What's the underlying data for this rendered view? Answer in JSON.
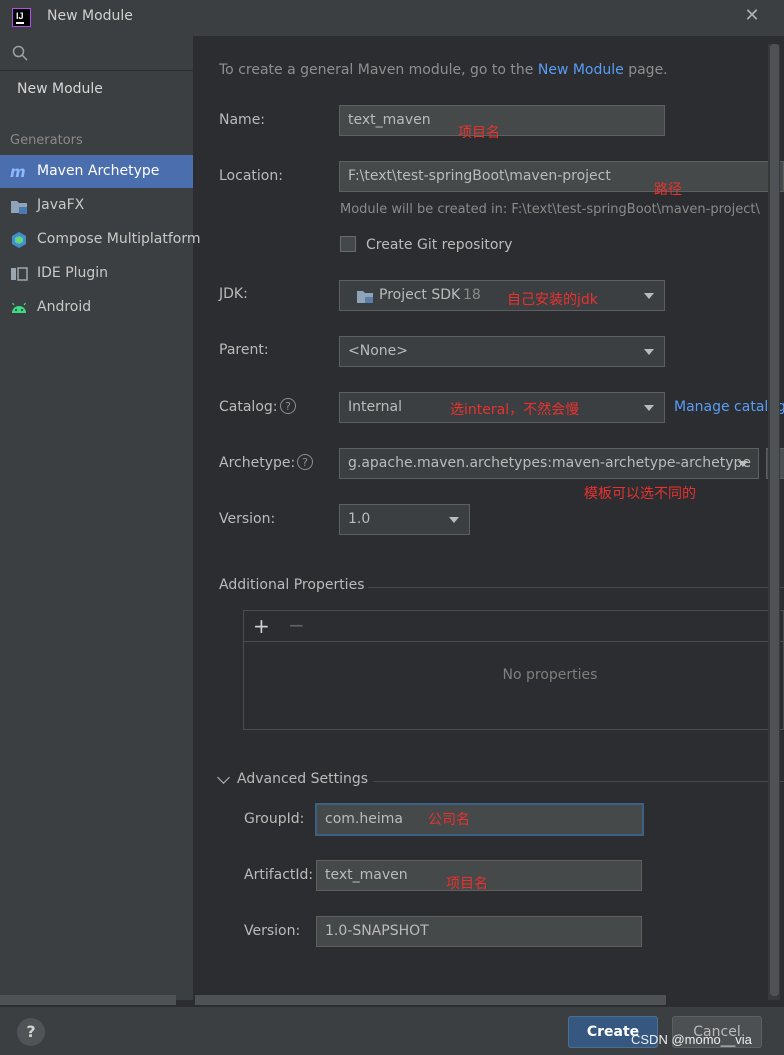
{
  "window": {
    "title": "New Module"
  },
  "sidebar": {
    "new_module": "New Module",
    "generators_label": "Generators",
    "items": [
      {
        "label": "Maven Archetype",
        "icon": "maven-icon",
        "selected": true
      },
      {
        "label": "JavaFX",
        "icon": "javafx-folder-icon"
      },
      {
        "label": "Compose Multiplatform",
        "icon": "compose-icon"
      },
      {
        "label": "IDE Plugin",
        "icon": "plugin-icon"
      },
      {
        "label": "Android",
        "icon": "android-icon"
      }
    ]
  },
  "intro": {
    "prefix": "To create a general Maven module, go to the ",
    "link": "New Module",
    "suffix": " page."
  },
  "form": {
    "name_label": "Name:",
    "name_value": "text_maven",
    "name_note": "项目名",
    "location_label": "Location:",
    "location_value": "F:\\text\\test-springBoot\\maven-project",
    "location_note": "路径",
    "location_hint": "Module will be created in: F:\\text\\test-springBoot\\maven-project\\",
    "git_label": "Create Git repository",
    "jdk_label": "JDK:",
    "jdk_value": "Project SDK",
    "jdk_version": "18",
    "jdk_note": "自己安装的jdk",
    "parent_label": "Parent:",
    "parent_value": "<None>",
    "catalog_label": "Catalog:",
    "catalog_value": "Internal",
    "catalog_note": "选interal，不然会慢",
    "manage_catalogs": "Manage catalog",
    "archetype_label": "Archetype:",
    "archetype_value": "g.apache.maven.archetypes:maven-archetype-archetype",
    "archetype_note": "模板可以选不同的",
    "version_label": "Version:",
    "version_value": "1.0"
  },
  "additional": {
    "title": "Additional Properties",
    "add": "+",
    "remove": "−",
    "empty": "No properties"
  },
  "advanced": {
    "title": "Advanced Settings",
    "groupid_label": "GroupId:",
    "groupid_value": "com.heima",
    "groupid_note": "公司名",
    "artifactid_label": "ArtifactId:",
    "artifactid_value": "text_maven",
    "artifactid_note": "项目名",
    "version_label": "Version:",
    "version_value": "1.0-SNAPSHOT"
  },
  "footer": {
    "help": "?",
    "create": "Create",
    "cancel": "Cancel"
  },
  "watermark": "CSDN @momo__via",
  "colors": {
    "accent": "#4b6eaf",
    "link": "#589df6",
    "annotation": "#e8322e"
  }
}
